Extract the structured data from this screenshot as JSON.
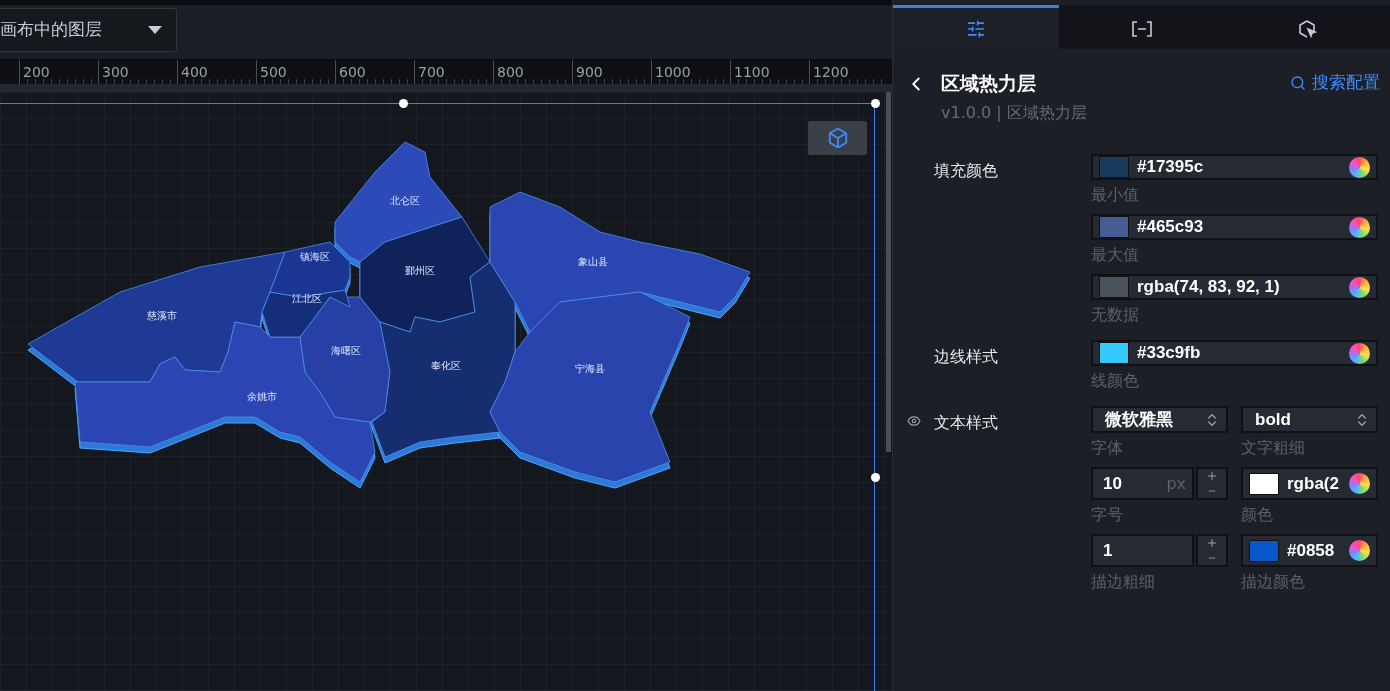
{
  "layer_search": {
    "value": "画布中的图层"
  },
  "ruler": {
    "ticks": [
      "200",
      "300",
      "400",
      "500",
      "600",
      "700",
      "800",
      "900",
      "1000",
      "1100",
      "1200"
    ]
  },
  "map": {
    "regions": [
      {
        "name": "慈溪市",
        "color": "#1e3a94"
      },
      {
        "name": "余姚市",
        "color": "#2b46b3"
      },
      {
        "name": "海曙区",
        "color": "#2640a6"
      },
      {
        "name": "江北区",
        "color": "#152e7a"
      },
      {
        "name": "镇海区",
        "color": "#1b3592"
      },
      {
        "name": "北仑区",
        "color": "#2d4ab9"
      },
      {
        "name": "鄞州区",
        "color": "#0f2259"
      },
      {
        "name": "奉化区",
        "color": "#162d70"
      },
      {
        "name": "象山县",
        "color": "#2a46b1"
      },
      {
        "name": "宁海县",
        "color": "#2a44ae"
      }
    ]
  },
  "panel": {
    "tabs": [
      {
        "kind": "sliders",
        "selected": true
      },
      {
        "kind": "bracket",
        "selected": false
      },
      {
        "kind": "cursor",
        "selected": false
      }
    ],
    "title": "区域热力层",
    "subtitle": "v1.0.0 | 区域热力层",
    "search_link": "搜索配置",
    "sections": [
      {
        "label": "填充颜色",
        "eye": false,
        "fields": [
          {
            "kind": "color",
            "value": "#17395c",
            "color": "#17395c",
            "caption": "最小值"
          },
          {
            "kind": "color",
            "value": "#465c93",
            "color": "#465c93",
            "caption": "最大值"
          },
          {
            "kind": "color",
            "value": "rgba(74, 83, 92, 1)",
            "color": "#4a535c",
            "caption": "无数据"
          }
        ]
      },
      {
        "label": "边线样式",
        "eye": false,
        "fields": [
          {
            "kind": "color",
            "value": "#33c9fb",
            "color": "#33c9fb",
            "caption": "线颜色"
          }
        ]
      },
      {
        "label": "文本样式",
        "eye": true,
        "fields": [
          {
            "kind": "select",
            "value": "微软雅黑",
            "caption": "字体"
          },
          {
            "kind": "select",
            "value": "bold",
            "caption": "文字粗细"
          },
          {
            "kind": "number",
            "value": "10",
            "unit": "px",
            "caption": "字号"
          },
          {
            "kind": "color",
            "value": "rgba(2",
            "color": "#ffffff",
            "caption": "颜色"
          },
          {
            "kind": "number",
            "value": "1",
            "caption": "描边粗细"
          },
          {
            "kind": "color",
            "value": "#0858",
            "color": "#0858cc",
            "caption": "描边颜色"
          }
        ]
      }
    ]
  }
}
